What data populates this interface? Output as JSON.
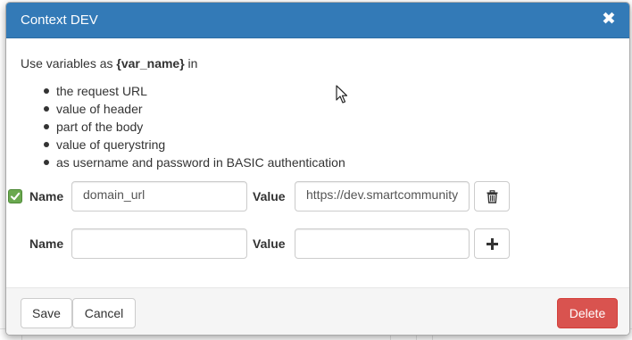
{
  "modal": {
    "title": "Context DEV",
    "close_glyph": "✖",
    "intro_prefix": "Use variables as ",
    "intro_var": "{var_name}",
    "intro_suffix": " in",
    "usage_items": [
      "the request URL",
      "value of header",
      "part of the body",
      "value of querystring",
      "as username and password in BASIC authentication"
    ]
  },
  "variables": [
    {
      "checked": true,
      "name_label": "Name",
      "name_value": "domain_url",
      "value_label": "Value",
      "value_value": "https://dev.smartcommunity",
      "action_icon": "trash-icon"
    }
  ],
  "new_variable": {
    "name_label": "Name",
    "name_value": "",
    "value_label": "Value",
    "value_value": "",
    "action_icon": "plus-icon"
  },
  "footer": {
    "save_label": "Save",
    "cancel_label": "Cancel",
    "delete_label": "Delete"
  },
  "colors": {
    "header": "#337ab7",
    "danger": "#d9534f",
    "check": "#6aa84f"
  }
}
